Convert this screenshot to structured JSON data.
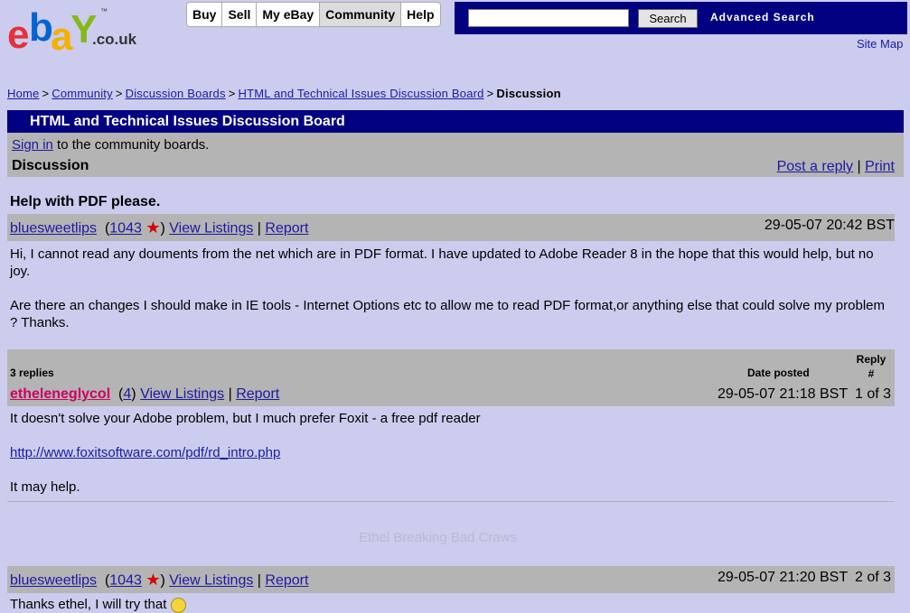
{
  "logo": {
    "text": "ebay",
    "tm": "™",
    "domain": ".co.uk"
  },
  "nav": {
    "tabs": [
      "Buy",
      "Sell",
      "My eBay",
      "Community",
      "Help"
    ],
    "active": "Community"
  },
  "search": {
    "value": "",
    "button_label": "Search",
    "advanced_label": "Advanced Search"
  },
  "site_map_label": "Site Map",
  "breadcrumb": {
    "items": [
      "Home",
      "Community",
      "Discussion Boards",
      "HTML and Technical Issues Discussion Board"
    ],
    "current": "Discussion"
  },
  "board": {
    "title": "HTML and Technical Issues Discussion Board"
  },
  "signin": {
    "link": "Sign in",
    "text": " to the community boards."
  },
  "discussion": {
    "label": "Discussion",
    "post_reply": "Post a reply",
    "print": "Print"
  },
  "topic": {
    "title": "Help with PDF please.",
    "author": "bluesweetlips",
    "feedback": "1043",
    "view_listings": "View Listings",
    "report": "Report",
    "date": "29-05-07 20:42 BST",
    "body": [
      "Hi, I cannot read any douments from the net which are in PDF format. I have updated to Adobe Reader 8 in the hope that this would help, but no joy.",
      "Are there an changes I should make in IE tools - Internet Options etc to allow me to read PDF format,or anything else that could solve my problem ? Thanks."
    ]
  },
  "replies": {
    "count_label": "3 replies",
    "date_posted_label": "Date posted",
    "reply_num_label": "Reply #",
    "items": [
      {
        "author": "etheleneglycol",
        "feedback": "4",
        "view_listings": "View Listings",
        "report": "Report",
        "date": "29-05-07 21:18 BST",
        "num": "1 of 3",
        "body": [
          "It doesn't solve your Adobe problem, but I much prefer Foxit - a free pdf reader"
        ],
        "link": "http://www.foxitsoftware.com/pdf/rd_intro.php",
        "body_end": "It may help.",
        "signature": "Ethel Breaking Bad Craws"
      },
      {
        "author": "bluesweetlips",
        "feedback": "1043",
        "view_listings": "View Listings",
        "report": "Report",
        "date": "29-05-07 21:20 BST",
        "num": "2 of 3",
        "body": [
          "Thanks ethel, I will try that"
        ]
      }
    ]
  }
}
